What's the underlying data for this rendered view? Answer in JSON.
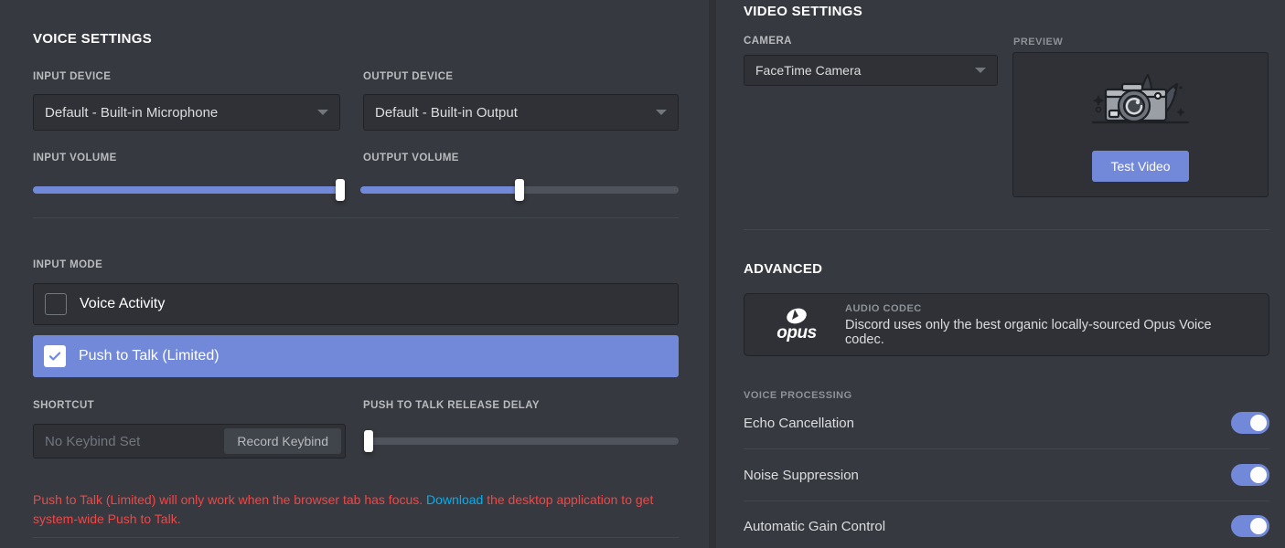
{
  "voice": {
    "section_title": "VOICE SETTINGS",
    "input_device_label": "INPUT DEVICE",
    "input_device_value": "Default - Built-in Microphone",
    "output_device_label": "OUTPUT DEVICE",
    "output_device_value": "Default - Built-in Output",
    "input_volume_label": "INPUT VOLUME",
    "input_volume_percent": 100,
    "output_volume_label": "OUTPUT VOLUME",
    "output_volume_percent": 50,
    "input_mode_label": "INPUT MODE",
    "modes": [
      {
        "label": "Voice Activity",
        "selected": false
      },
      {
        "label": "Push to Talk (Limited)",
        "selected": true
      }
    ],
    "shortcut_label": "SHORTCUT",
    "shortcut_placeholder": "No Keybind Set",
    "record_keybind_label": "Record Keybind",
    "release_delay_label": "PUSH TO TALK RELEASE DELAY",
    "release_delay_percent": 1,
    "warning_text_before": "Push to Talk (Limited) will only work when the browser tab has focus. ",
    "warning_link": "Download",
    "warning_text_after": " the desktop application to get system-wide Push to Talk."
  },
  "video": {
    "section_title": "VIDEO SETTINGS",
    "camera_label": "CAMERA",
    "camera_value": "FaceTime Camera",
    "preview_label": "PREVIEW",
    "test_video_label": "Test Video"
  },
  "advanced": {
    "section_title": "ADVANCED",
    "codec_kicker": "AUDIO CODEC",
    "codec_name": "opus",
    "codec_description": "Discord uses only the best organic locally-sourced Opus Voice codec.",
    "voice_processing_label": "VOICE PROCESSING",
    "toggles": [
      {
        "label": "Echo Cancellation",
        "on": true
      },
      {
        "label": "Noise Suppression",
        "on": true
      },
      {
        "label": "Automatic Gain Control",
        "on": true
      }
    ]
  },
  "colors": {
    "background": "#36393f",
    "surface": "#2f3136",
    "accent": "#7289da",
    "danger": "#f04747",
    "link": "#00aff4",
    "text_primary": "#dcddde",
    "text_muted": "#b9bbbe"
  }
}
